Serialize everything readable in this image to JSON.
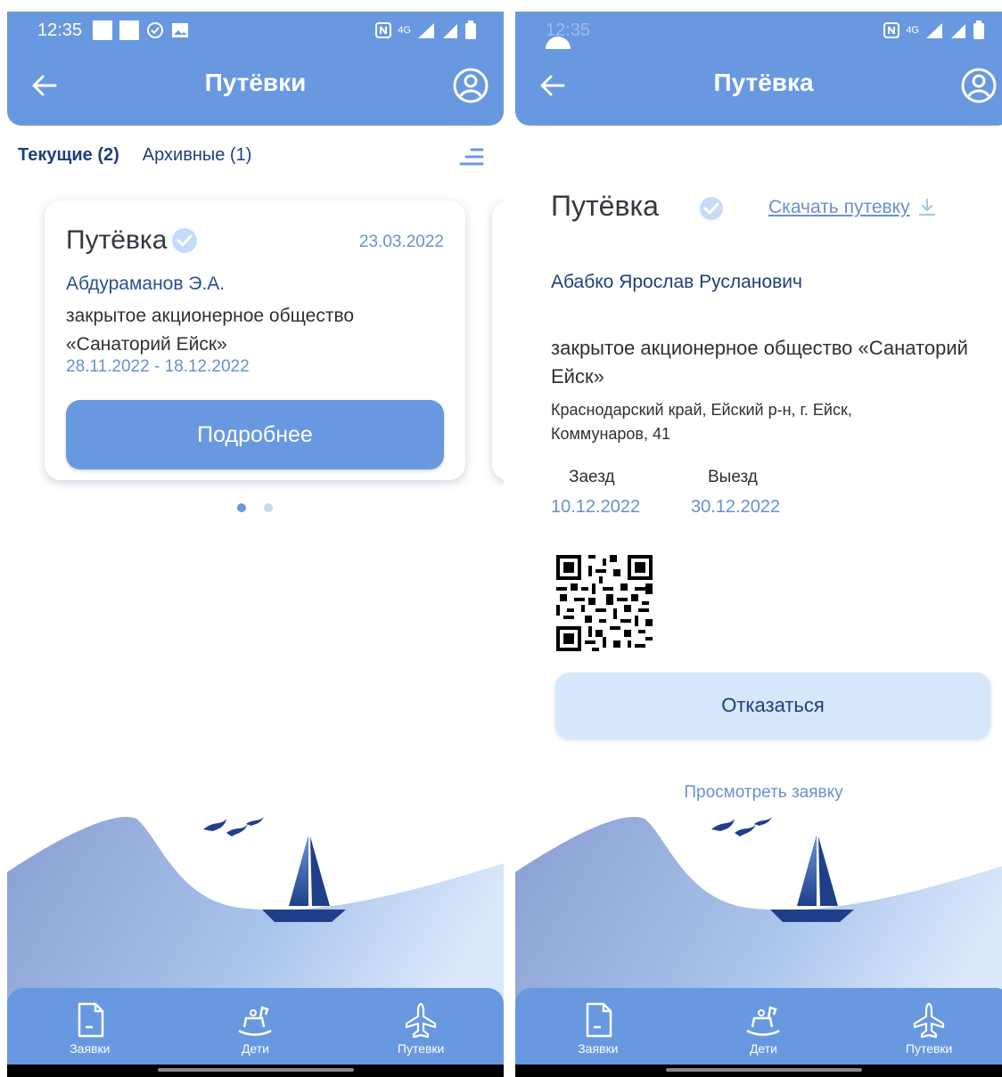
{
  "left": {
    "status_bar": {
      "time": "12:35",
      "network": "4G"
    },
    "app_bar": {
      "title": "Путёвки"
    },
    "tabs": {
      "current": "Текущие (2)",
      "archive": "Архивные (1)"
    },
    "card": {
      "title": "Путёвка",
      "date": "23.03.2022",
      "person": "Абдураманов Э.А.",
      "organization": "закрытое акционерное общество «Санаторий Ейск»",
      "period": "28.11.2022 - 18.12.2022",
      "button_label": "Подробнее"
    },
    "pager": {
      "count": 2,
      "active": 0
    }
  },
  "right": {
    "status_bar": {
      "time": "12:35",
      "network": "4G"
    },
    "app_bar": {
      "title": "Путёвка"
    },
    "voucher": {
      "title": "Путёвка",
      "download_label": "Скачать путевку",
      "person": "Абабко Ярослав Русланович",
      "organization": "закрытое акционерное общество «Санаторий Ейск»",
      "address": "Краснодарский край, Ейский р-н, г. Ейск, Коммунаров, 41",
      "checkin_label": "Заезд",
      "checkout_label": "Выезд",
      "checkin_date": "10.12.2022",
      "checkout_date": "30.12.2022",
      "refuse_label": "Отказаться",
      "view_request_label": "Просмотреть заявку"
    }
  },
  "bottom_nav": {
    "items": [
      {
        "label": "Заявки",
        "icon": "document-icon"
      },
      {
        "label": "Дети",
        "icon": "rocking-horse-icon"
      },
      {
        "label": "Путевки",
        "icon": "airplane-icon"
      }
    ]
  },
  "colors": {
    "primary": "#6898e0",
    "dark_text": "#1f3f7a",
    "link": "#6a8fcf",
    "button_light": "#d6e6fb"
  }
}
